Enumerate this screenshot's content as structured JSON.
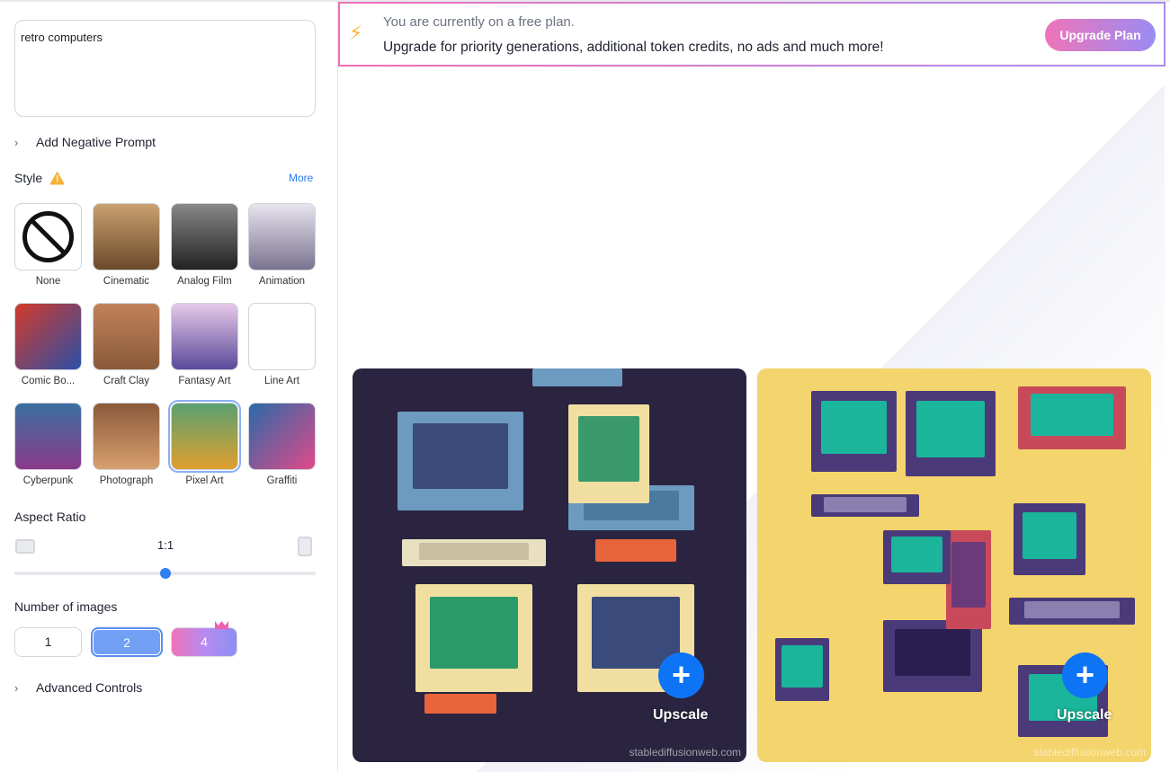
{
  "prompt": {
    "value": "retro computers"
  },
  "negative_prompt_label": "Add Negative Prompt",
  "style": {
    "label": "Style",
    "more": "More",
    "selected": "Pixel Art",
    "items": [
      {
        "label": "None"
      },
      {
        "label": "Cinematic"
      },
      {
        "label": "Analog Film"
      },
      {
        "label": "Animation"
      },
      {
        "label": "Comic Bo..."
      },
      {
        "label": "Craft Clay"
      },
      {
        "label": "Fantasy Art"
      },
      {
        "label": "Line Art"
      },
      {
        "label": "Cyberpunk"
      },
      {
        "label": "Photograph"
      },
      {
        "label": "Pixel Art"
      },
      {
        "label": "Graffiti"
      }
    ]
  },
  "aspect": {
    "label": "Aspect Ratio",
    "value": "1:1",
    "slider_position_pct": 50
  },
  "num_images": {
    "label": "Number of images",
    "options": [
      "1",
      "2",
      "4"
    ],
    "selected": "2"
  },
  "advanced_label": "Advanced Controls",
  "banner": {
    "line1": "You are currently on a free plan.",
    "line2": "Upgrade for priority generations, additional token credits, no ads and much more!",
    "button": "Upgrade Plan"
  },
  "results": [
    {
      "upscale": "Upscale",
      "watermark": "stablediffusionweb.com"
    },
    {
      "upscale": "Upscale",
      "watermark": "stablediffusionweb.com"
    }
  ],
  "colors": {
    "accent": "#0d74f6",
    "link": "#2a7cf0",
    "selected": "#71a0f5"
  }
}
